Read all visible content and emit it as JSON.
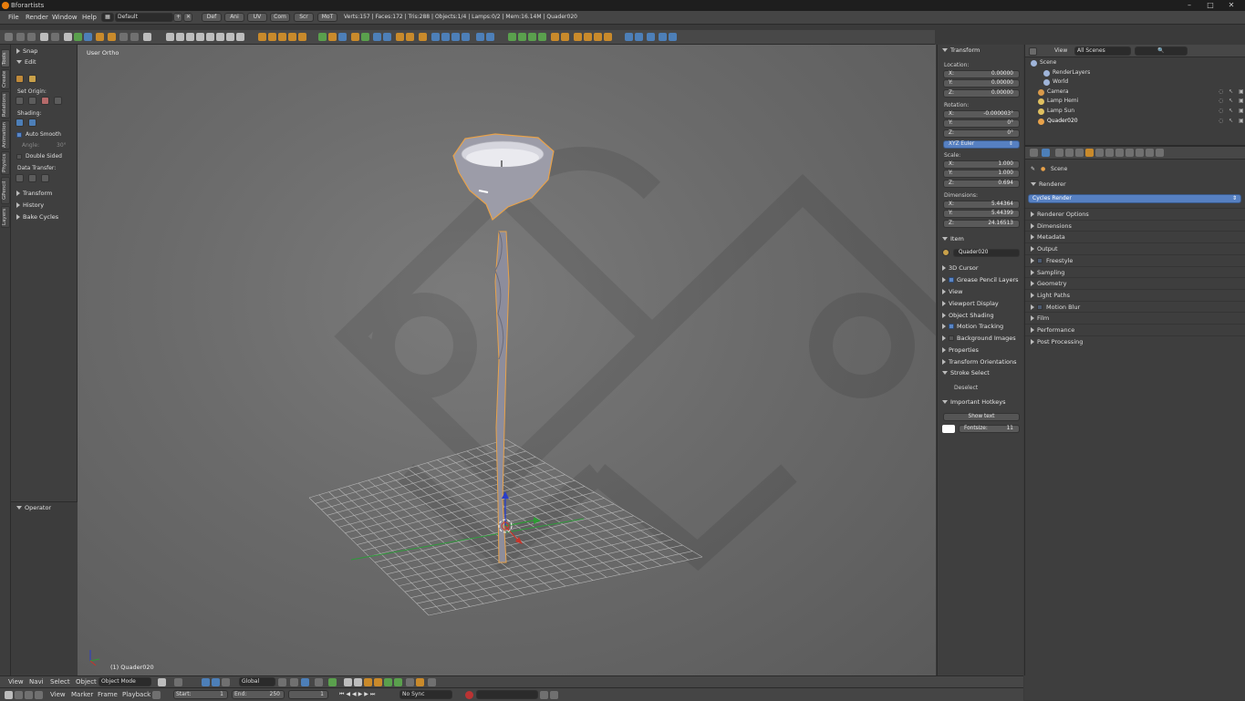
{
  "titlebar": {
    "title": "Bforartists"
  },
  "info": {
    "menus": [
      "File",
      "Render",
      "Window",
      "Help"
    ],
    "layout": "Default",
    "workspaces": [
      "Def",
      "Ani",
      "UV",
      "Com",
      "Scr",
      "MoT"
    ],
    "stats": "Verts:157 | Faces:172 | Tris:288 | Objects:1/4 | Lamps:0/2 | Mem:16.14M | Quader020"
  },
  "tabs": [
    "Tools",
    "Create",
    "Relations",
    "Animation",
    "Physics",
    "GPencil",
    "Layers"
  ],
  "toolshelf": {
    "snap": "Snap",
    "edit": "Edit",
    "set_origin": "Set Origin:",
    "shading": "Shading:",
    "auto_smooth": "Auto Smooth",
    "angle_label": "Angle:",
    "angle_value": "30°",
    "double_sided": "Double Sided",
    "data_transfer": "Data Transfer:",
    "transform": "Transform",
    "history": "History",
    "bake_cycles": "Bake Cycles",
    "operator": "Operator"
  },
  "viewport": {
    "view_label": "User Ortho",
    "object_label": "(1) Quader020"
  },
  "npanel": {
    "transform": "Transform",
    "location": "Location:",
    "loc": [
      {
        "k": "X:",
        "v": "0.00000"
      },
      {
        "k": "Y:",
        "v": "0.00000"
      },
      {
        "k": "Z:",
        "v": "0.00000"
      }
    ],
    "rotation": "Rotation:",
    "rot": [
      {
        "k": "X:",
        "v": "-0.000003°"
      },
      {
        "k": "Y:",
        "v": "0°"
      },
      {
        "k": "Z:",
        "v": "0°"
      }
    ],
    "rot_mode": "XYZ Euler",
    "scale": "Scale:",
    "scl": [
      {
        "k": "X:",
        "v": "1.000"
      },
      {
        "k": "Y:",
        "v": "1.000"
      },
      {
        "k": "Z:",
        "v": "0.694"
      }
    ],
    "dimensions": "Dimensions:",
    "dim": [
      {
        "k": "X:",
        "v": "5.44364"
      },
      {
        "k": "Y:",
        "v": "5.44399"
      },
      {
        "k": "Z:",
        "v": "24.16513"
      }
    ],
    "item": "Item",
    "item_name": "Quader020",
    "sections": [
      "3D Cursor",
      "Grease Pencil Layers",
      "View",
      "Viewport Display",
      "Object Shading",
      "Motion Tracking",
      "Background Images",
      "Properties",
      "Transform Orientations",
      "Stroke Select"
    ],
    "deselect": "Deselect",
    "hotkeys": "Important Hotkeys",
    "show_text": "Show text",
    "fontsize_label": "Fontsize:",
    "fontsize_value": "11"
  },
  "outliner": {
    "view": "View",
    "scenes": "All Scenes",
    "items": [
      "Scene",
      "RenderLayers",
      "World",
      "Camera",
      "Lamp Hemi",
      "Lamp Sun",
      "Quader020"
    ]
  },
  "properties": {
    "scene": "Scene",
    "renderer": "Renderer",
    "engine": "Cycles Render",
    "sections": [
      "Renderer Options",
      "Dimensions",
      "Metadata",
      "Output",
      "Freestyle",
      "Sampling",
      "Geometry",
      "Light Paths",
      "Motion Blur",
      "Film",
      "Performance",
      "Post Processing"
    ]
  },
  "bottom": {
    "menus": [
      "View",
      "Navi",
      "Select",
      "Object"
    ],
    "mode": "Object Mode",
    "orientation": "Global",
    "timeline_menus": [
      "View",
      "Marker",
      "Frame",
      "Playback"
    ],
    "start_label": "Start:",
    "start": "1",
    "end_label": "End:",
    "end": "250",
    "current": "1",
    "sync": "No Sync"
  },
  "colors": {
    "accent": "#5680c2",
    "selection": "#e8a24a",
    "header": "#474747"
  }
}
